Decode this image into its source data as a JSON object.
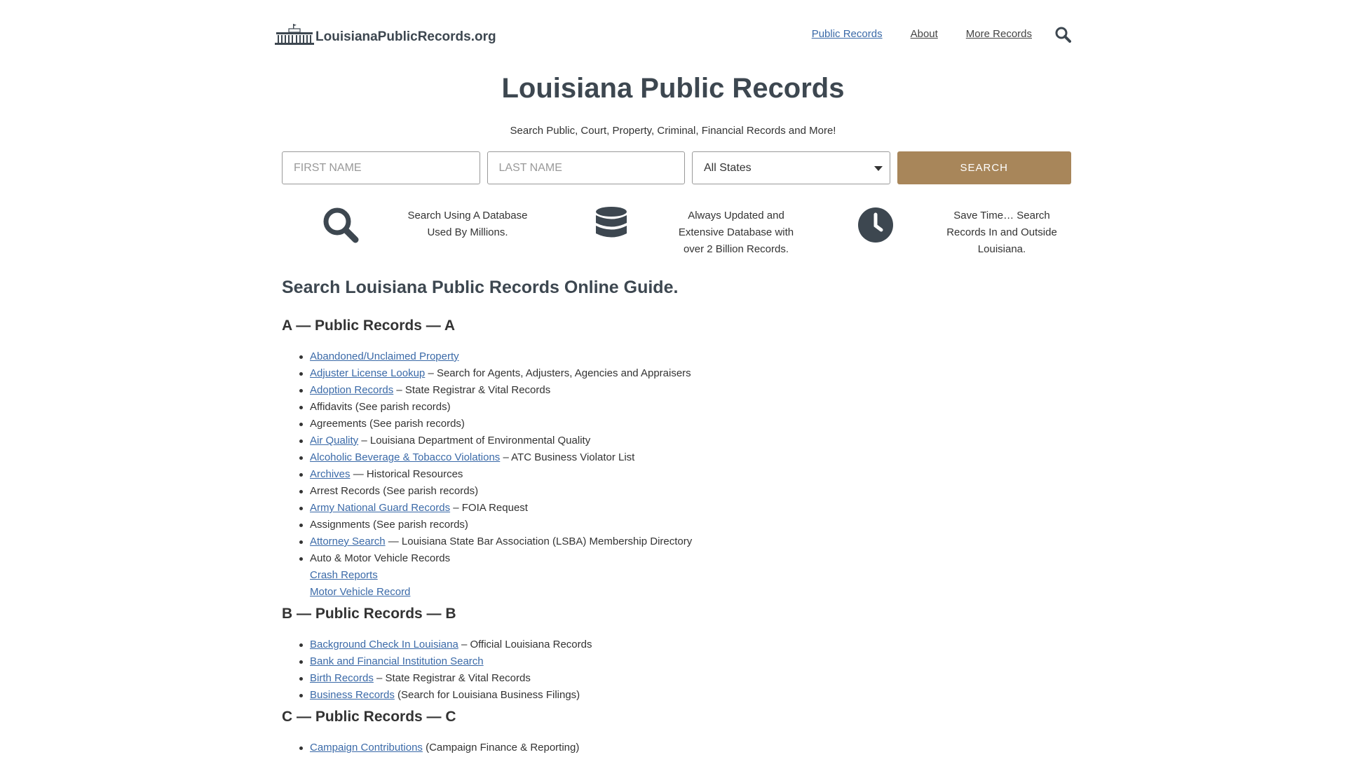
{
  "header": {
    "logo_text": "LouisianaPublicRecords.org",
    "nav": [
      {
        "label": "Public Records"
      },
      {
        "label": "About"
      },
      {
        "label": "More Records"
      }
    ]
  },
  "hero": {
    "title": "Louisiana Public Records",
    "subtitle": "Search Public, Court, Property, Criminal, Financial Records and More!"
  },
  "search": {
    "first_name_placeholder": "FIRST NAME",
    "last_name_placeholder": "LAST NAME",
    "state_value": "All States",
    "button_label": "SEARCH"
  },
  "features": [
    {
      "icon": "search-icon",
      "text": "Search Using A Database Used By Millions."
    },
    {
      "icon": "database-icon",
      "text": "Always Updated and Extensive Database with over 2 Billion Records."
    },
    {
      "icon": "clock-icon",
      "text": "Save Time… Search Records In and Outside Louisiana."
    }
  ],
  "guide": {
    "title": "Search Louisiana Public Records Online Guide.",
    "sections": [
      {
        "heading": "A — Public Records — A",
        "items": [
          {
            "link": "Abandoned/Unclaimed Property",
            "text": ""
          },
          {
            "link": "Adjuster License Lookup",
            "text": " – Search for Agents, Adjusters, Agencies and Appraisers"
          },
          {
            "link": "Adoption Records",
            "text": " – State Registrar & Vital Records"
          },
          {
            "link": "",
            "text": "Affidavits (See parish records)"
          },
          {
            "link": "",
            "text": "Agreements (See parish records)"
          },
          {
            "link": "Air Quality",
            "text": " – Louisiana Department of Environmental Quality"
          },
          {
            "link": "Alcoholic Beverage & Tobacco Violations",
            "text": " – ATC Business Violator List"
          },
          {
            "link": "Archives",
            "text": " — Historical Resources"
          },
          {
            "link": "",
            "text": "Arrest Records (See parish records)"
          },
          {
            "link": "Army National Guard Records",
            "text": " – FOIA Request"
          },
          {
            "link": "",
            "text": "Assignments (See parish records)"
          },
          {
            "link": "Attorney Search",
            "text": " — Louisiana State Bar Association (LSBA) Membership Directory"
          },
          {
            "link": "",
            "text": "Auto & Motor Vehicle Records"
          },
          {
            "link": "Crash Reports",
            "text": "",
            "sub": true
          },
          {
            "link": "Motor Vehicle Record",
            "text": "",
            "sub": true
          }
        ]
      },
      {
        "heading": "B — Public Records — B",
        "items": [
          {
            "link": "Background Check In Louisiana",
            "text": " – Official Louisiana Records"
          },
          {
            "link": "Bank and Financial Institution Search",
            "text": ""
          },
          {
            "link": "Birth Records",
            "text": " – State Registrar & Vital Records"
          },
          {
            "link": "Business Records",
            "text": " (Search for Louisiana Business Filings)"
          }
        ]
      },
      {
        "heading": "C — Public Records — C",
        "items": [
          {
            "link": "Campaign Contributions",
            "text": " (Campaign Finance & Reporting)"
          }
        ]
      }
    ]
  },
  "colors": {
    "accent_button": "#a8865a",
    "link": "#3b6aa8",
    "heading": "#3d4750"
  }
}
